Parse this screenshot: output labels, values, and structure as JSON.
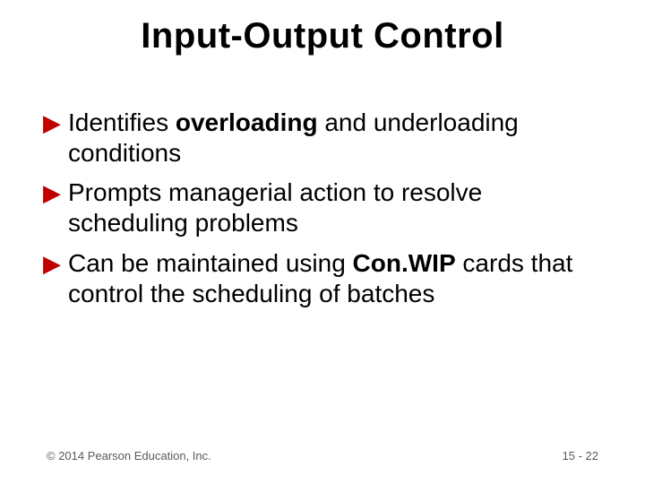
{
  "title": "Input-Output Control",
  "bullets": [
    {
      "pre": "Identifies ",
      "bold": "overloading",
      "post": " and underloading conditions"
    },
    {
      "pre": "Prompts managerial action to resolve scheduling problems",
      "bold": "",
      "post": ""
    },
    {
      "pre": "Can be maintained using ",
      "bold": "Con.WIP",
      "post": " cards that control the scheduling of batches"
    }
  ],
  "footer": {
    "copyright": "© 2014 Pearson Education, Inc.",
    "pagenum": "15 - 22"
  }
}
